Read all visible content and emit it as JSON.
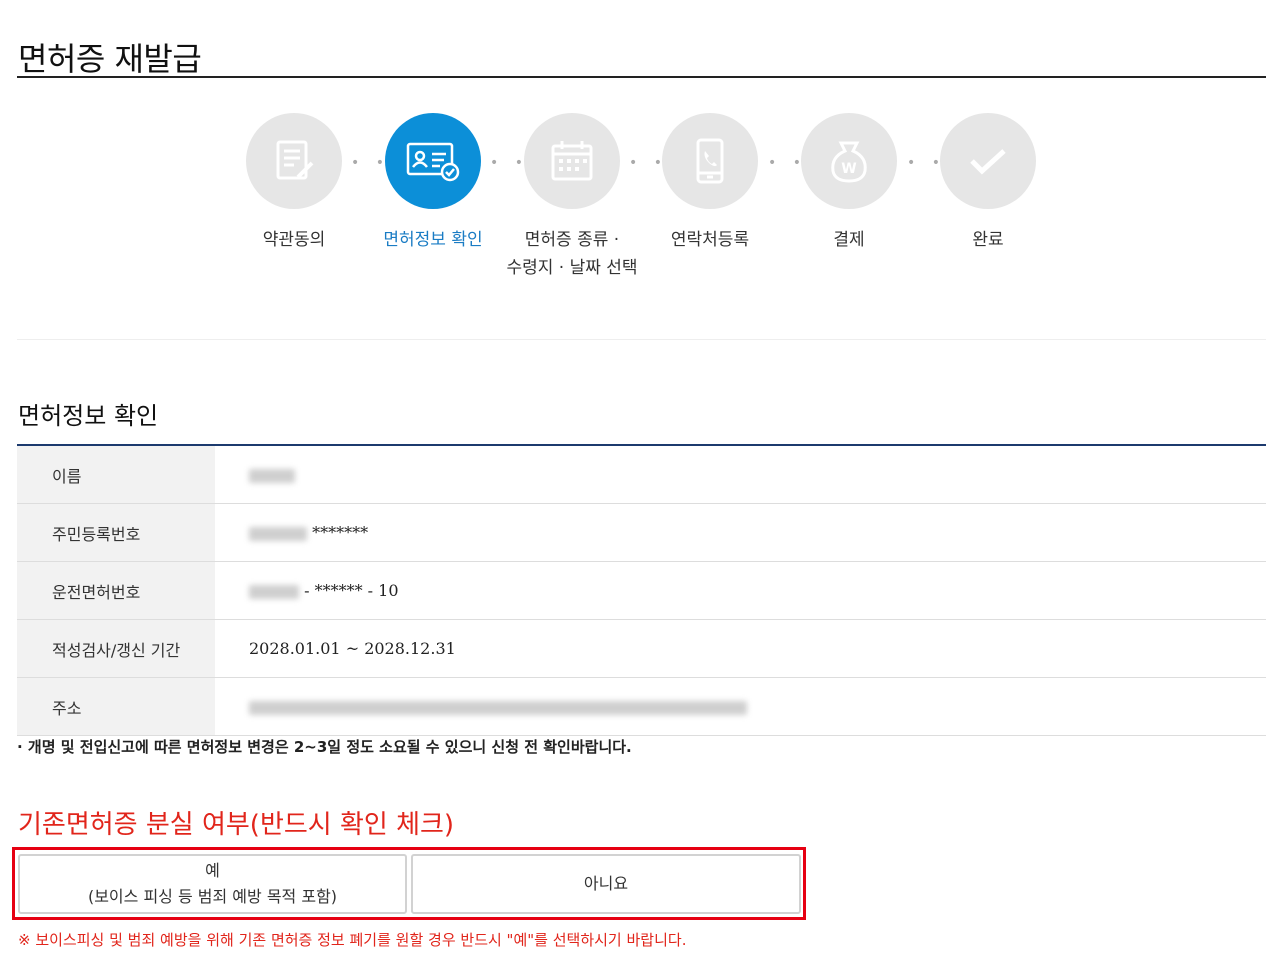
{
  "page": {
    "title": "면허증 재발급"
  },
  "steps": [
    {
      "line1": "약관동의",
      "line2": "",
      "icon": "document-edit-icon",
      "active": false
    },
    {
      "line1": "면허정보 확인",
      "line2": "",
      "icon": "id-card-check-icon",
      "active": true
    },
    {
      "line1": "면허증 종류 ·",
      "line2": "수령지 · 날짜 선택",
      "icon": "calendar-icon",
      "active": false
    },
    {
      "line1": "연락처등록",
      "line2": "",
      "icon": "phone-icon",
      "active": false
    },
    {
      "line1": "결제",
      "line2": "",
      "icon": "money-bag-icon",
      "active": false
    },
    {
      "line1": "완료",
      "line2": "",
      "icon": "checkmark-icon",
      "active": false
    }
  ],
  "section": {
    "title": "면허정보 확인"
  },
  "info": {
    "name_label": "이름",
    "rrn_label": "주민등록번호",
    "rrn_value": "*******",
    "license_label": "운전면허번호",
    "license_value": "- ****** - 10",
    "period_label": "적성검사/갱신 기간",
    "period_value": "2028.01.01 ~ 2028.12.31",
    "address_label": "주소"
  },
  "notice": "· 개명 및 전입신고에 따른 면허정보 변경은 2~3일 정도 소요될 수 있으니 신청 전 확인바랍니다.",
  "question": "기존면허증 분실 여부(반드시 확인 체크)",
  "choices": {
    "yes_line1": "예",
    "yes_line2": "(보이스 피싱 등 범죄 예방 목적 포함)",
    "no": "아니요"
  },
  "warning": "※ 보이스피싱 및 범죄 예방을 위해 기존 면허증 정보 폐기를 원할 경우 반드시 \"예\"를 선택하시기 바랍니다.",
  "colors": {
    "active_step": "#0c8fd8",
    "inactive_step": "#e6e6e6",
    "alert_red": "#e1251b",
    "section_rule": "#1c3a6e"
  }
}
